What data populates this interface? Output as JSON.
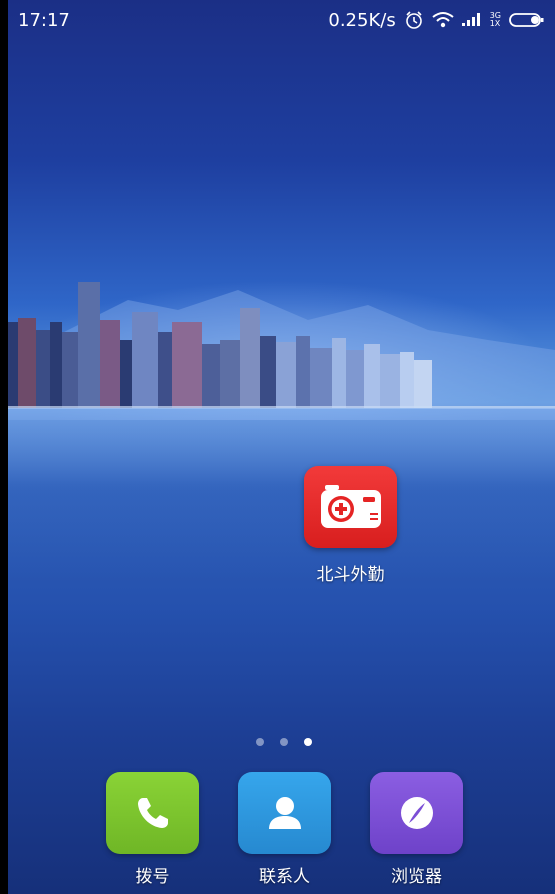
{
  "status_bar": {
    "time": "17:17",
    "network_speed": "0.25K/s",
    "net_type_top": "3G",
    "net_type_bottom": "1X"
  },
  "home": {
    "apps": [
      {
        "label": "北斗外勤",
        "icon": "camera-plus-icon",
        "color": "#e52424"
      }
    ],
    "page_indicator": {
      "pages": 3,
      "active": 3
    }
  },
  "dock": {
    "items": [
      {
        "label": "拨号",
        "icon": "phone-icon",
        "color": "#7dc42f"
      },
      {
        "label": "联系人",
        "icon": "contacts-icon",
        "color": "#2e97dc"
      },
      {
        "label": "浏览器",
        "icon": "browser-icon",
        "color": "#7c4fd6"
      }
    ]
  }
}
